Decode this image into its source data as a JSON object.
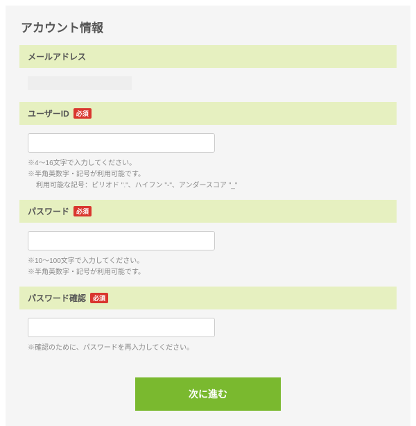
{
  "title": "アカウント情報",
  "required_label": "必須",
  "sections": {
    "email": {
      "label": "メールアドレス",
      "value": ""
    },
    "user_id": {
      "label": "ユーザーID",
      "help_line1": "※4〜16文字で入力してください。",
      "help_line2": "※半角英数字・記号が利用可能です。",
      "help_line3": "利用可能な記号：ピリオド \".\"、ハイフン \"-\"、アンダースコア \"_\"",
      "value": ""
    },
    "password": {
      "label": "パスワード",
      "help_line1": "※10〜100文字で入力してください。",
      "help_line2": "※半角英数字・記号が利用可能です。",
      "value": ""
    },
    "password_confirm": {
      "label": "パスワード確認",
      "help_line1": "※確認のために、パスワードを再入力してください。",
      "value": ""
    }
  },
  "submit_label": "次に進む"
}
